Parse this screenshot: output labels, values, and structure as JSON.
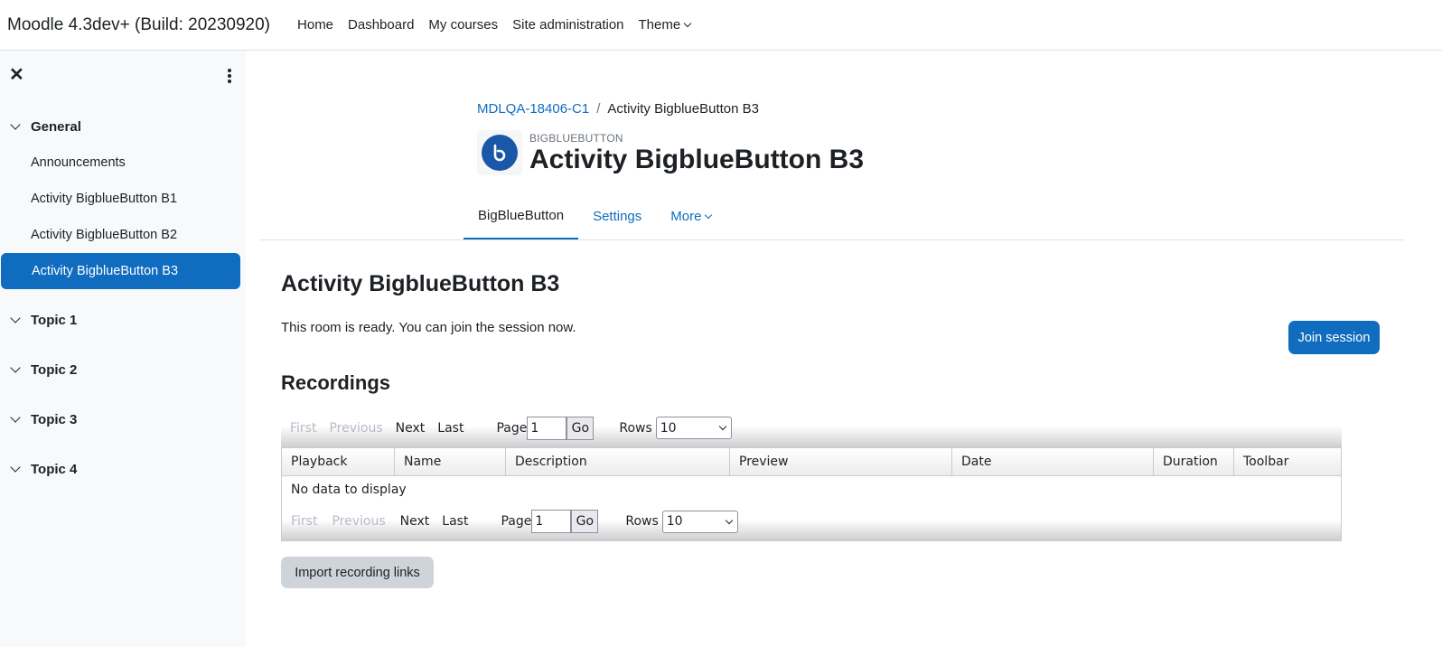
{
  "navbar": {
    "site_name": "Moodle 4.3dev+ (Build: 20230920)",
    "items": [
      "Home",
      "Dashboard",
      "My courses",
      "Site administration",
      "Theme"
    ]
  },
  "drawer": {
    "sections": [
      {
        "title": "General",
        "items": [
          "Announcements",
          "Activity BigblueButton B1",
          "Activity BigblueButton B2",
          "Activity BigblueButton B3"
        ],
        "active": "Activity BigblueButton B3"
      },
      {
        "title": "Topic 1"
      },
      {
        "title": "Topic 2"
      },
      {
        "title": "Topic 3"
      },
      {
        "title": "Topic 4"
      }
    ]
  },
  "breadcrumb": {
    "course": "MDLQA-18406-C1",
    "separator": "/",
    "current": "Activity BigblueButton B3"
  },
  "header": {
    "module_type": "BIGBLUEBUTTON",
    "title": "Activity BigblueButton B3"
  },
  "secondary_nav": {
    "tabs": [
      "BigBlueButton",
      "Settings",
      "More"
    ],
    "active": "BigBlueButton"
  },
  "main": {
    "heading": "Activity BigblueButton B3",
    "status": "This room is ready. You can join the session now.",
    "join_button": "Join session",
    "recordings_heading": "Recordings",
    "import_button": "Import recording links"
  },
  "pager": {
    "first": "First",
    "previous": "Previous",
    "next": "Next",
    "last": "Last",
    "page_label": "Page",
    "page_value": "1",
    "go": "Go",
    "rows_label": "Rows",
    "rows_value": "10"
  },
  "table": {
    "columns": [
      "Playback",
      "Name",
      "Description",
      "Preview",
      "Date",
      "Duration",
      "Toolbar"
    ],
    "empty_message": "No data to display"
  },
  "colors": {
    "accent": "#0f6cbf",
    "drawer_bg": "#f8f9fa",
    "icon_bg": "#1a57a8"
  }
}
